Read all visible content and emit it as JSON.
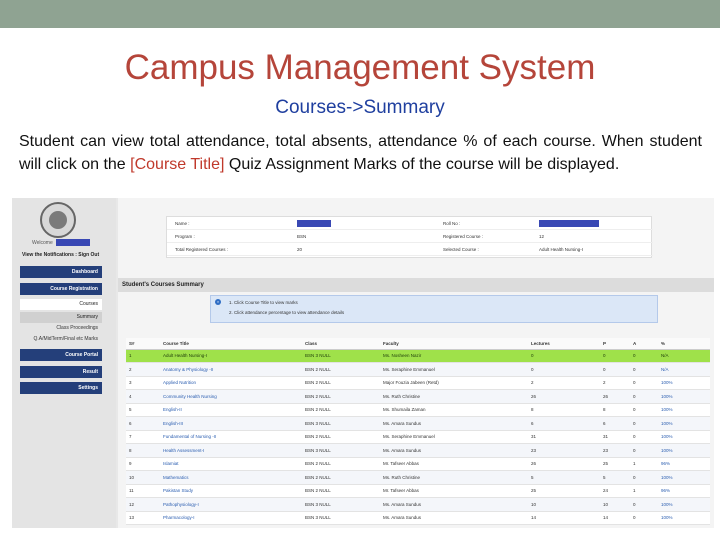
{
  "slide": {
    "title": "Campus Management System",
    "subtitle": "Courses->Summary",
    "desc_before": "Student can view total attendance, total absents, attendance % of each course. When student will click on the ",
    "desc_highlight": "[Course Title]",
    "desc_after": " Quiz Assignment Marks of the course will be displayed."
  },
  "sidebar": {
    "welcome": "Welcome",
    "notifications": "View the Notifications : Sign Out",
    "items": [
      {
        "label": "Dashboard"
      },
      {
        "label": "Course Registration"
      },
      {
        "label": "Courses"
      },
      {
        "label": "Summary"
      },
      {
        "label": "Class Proceedings"
      },
      {
        "label": "Q.A/MidTerm/Final etc Marks"
      },
      {
        "label": "Course Portal"
      },
      {
        "label": "Result"
      },
      {
        "label": "Settings"
      }
    ]
  },
  "student_info": {
    "name_label": "Name :",
    "roll_label": "Roll No :",
    "program_label": "Program :",
    "program_value": "BSN",
    "registered_label": "Registered Course :",
    "registered_value": "12",
    "total_label": "Total Registered Courses :",
    "total_value": "20",
    "selected_label": "Selected Course :",
    "selected_value": "Adult Health Nursing-I"
  },
  "summary": {
    "heading": "Student's Courses Summary",
    "alert_lines": [
      "1. Click Course Title to view marks",
      "2. Click attendance percentage to view attendance details"
    ],
    "columns": [
      "S#",
      "Course Title",
      "Class",
      "Faculty",
      "Lectures",
      "P",
      "A",
      "%"
    ],
    "rows": [
      [
        "1",
        "Adult Health Nursing-I",
        "BSN 3 NULL",
        "Ms. Nosheen Nazir",
        "0",
        "0",
        "0",
        "N/A"
      ],
      [
        "2",
        "Anatomy & Physiology -II",
        "BSN 2 NULL",
        "Ms. Seraphine Emmanuel",
        "0",
        "0",
        "0",
        "N/A"
      ],
      [
        "3",
        "Applied Nutrition",
        "BSN 2 NULL",
        "Major Fouzia Jabeen (Retd)",
        "2",
        "2",
        "0",
        "100%"
      ],
      [
        "4",
        "Community Health Nursing",
        "BSN 2 NULL",
        "Ms. Ruth Christine",
        "26",
        "26",
        "0",
        "100%"
      ],
      [
        "5",
        "English-II",
        "BSN 2 NULL",
        "Ms. Shumaila Zaman",
        "8",
        "8",
        "0",
        "100%"
      ],
      [
        "6",
        "English-III",
        "BSN 3 NULL",
        "Ms. Amara Sundus",
        "6",
        "6",
        "0",
        "100%"
      ],
      [
        "7",
        "Fundamental of Nursing -II",
        "BSN 2 NULL",
        "Ms. Seraphine Emmanuel",
        "31",
        "31",
        "0",
        "100%"
      ],
      [
        "8",
        "Health Assessment-I",
        "BSN 3 NULL",
        "Ms. Amara Sundus",
        "23",
        "23",
        "0",
        "100%"
      ],
      [
        "9",
        "Islamiat",
        "BSN 2 NULL",
        "Mr. Tafseer Abbas",
        "26",
        "25",
        "1",
        "96%"
      ],
      [
        "10",
        "Mathematics",
        "BSN 2 NULL",
        "Ms. Ruth Christine",
        "5",
        "5",
        "0",
        "100%"
      ],
      [
        "11",
        "Pakistan Study",
        "BSN 2 NULL",
        "Mr. Tafseer Abbas",
        "25",
        "24",
        "1",
        "96%"
      ],
      [
        "12",
        "Pathophysiology-I",
        "BSN 3 NULL",
        "Ms. Amara Sundus",
        "10",
        "10",
        "0",
        "100%"
      ],
      [
        "13",
        "Pharmacology-I",
        "BSN 3 NULL",
        "Ms. Amara Sundus",
        "14",
        "14",
        "0",
        "100%"
      ]
    ]
  },
  "colors": {
    "title": "#b5453a",
    "subtitle": "#1f3f9f",
    "nav": "#243f7a",
    "selected_row": "#9fe14a"
  }
}
